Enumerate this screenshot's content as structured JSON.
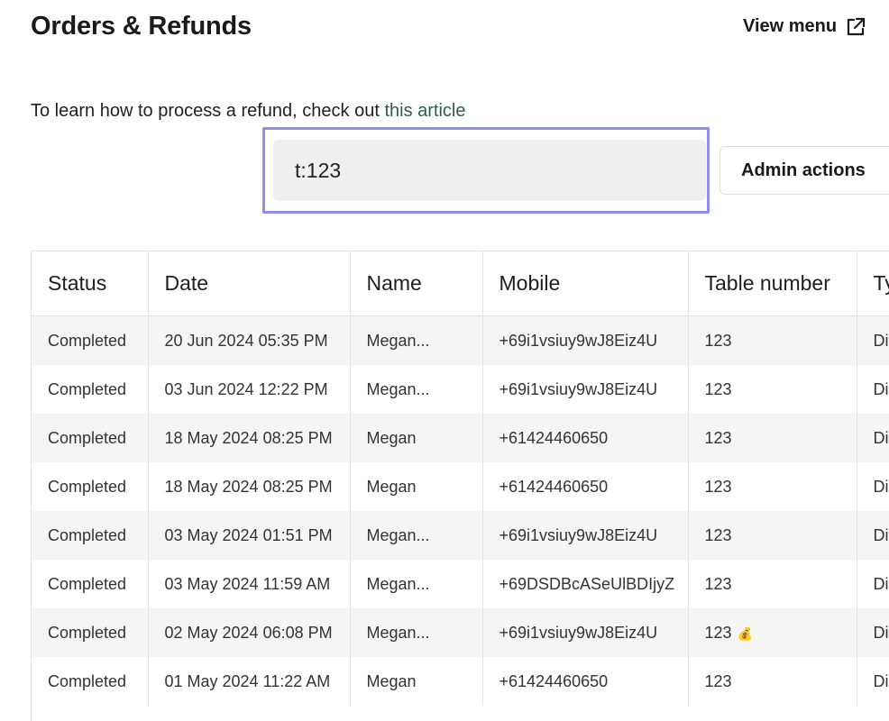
{
  "header": {
    "title": "Orders & Refunds",
    "view_menu_label": "View menu",
    "view_menu_icon": "external-link-icon"
  },
  "help": {
    "text": "To learn how to process a refund, check out ",
    "link_text": "this article"
  },
  "search": {
    "value": "t:123",
    "focus_color": "#8f8ef0"
  },
  "admin_actions_label": "Admin actions",
  "table": {
    "columns": [
      "Status",
      "Date",
      "Name",
      "Mobile",
      "Table number",
      "Type"
    ],
    "rows": [
      {
        "status": "Completed",
        "date": "20 Jun 2024 05:35 PM",
        "name": "Megan...",
        "mobile": "+69i1vsiuy9wJ8Eiz4U",
        "table_number": "123",
        "type": "Dine-in",
        "icon": ""
      },
      {
        "status": "Completed",
        "date": "03 Jun 2024 12:22 PM",
        "name": "Megan...",
        "mobile": "+69i1vsiuy9wJ8Eiz4U",
        "table_number": "123",
        "type": "Dine-in",
        "icon": ""
      },
      {
        "status": "Completed",
        "date": "18 May 2024 08:25 PM",
        "name": "Megan",
        "mobile": "+61424460650",
        "table_number": "123",
        "type": "Dine-in",
        "icon": ""
      },
      {
        "status": "Completed",
        "date": "18 May 2024 08:25 PM",
        "name": "Megan",
        "mobile": "+61424460650",
        "table_number": "123",
        "type": "Dine-in",
        "icon": ""
      },
      {
        "status": "Completed",
        "date": "03 May 2024 01:51 PM",
        "name": "Megan...",
        "mobile": "+69i1vsiuy9wJ8Eiz4U",
        "table_number": "123",
        "type": "Dine-in",
        "icon": ""
      },
      {
        "status": "Completed",
        "date": "03 May 2024 11:59 AM",
        "name": "Megan...",
        "mobile": "+69DSDBcASeUlBDIjyZ",
        "table_number": "123",
        "type": "Dine-in",
        "icon": ""
      },
      {
        "status": "Completed",
        "date": "02 May 2024 06:08 PM",
        "name": "Megan...",
        "mobile": "+69i1vsiuy9wJ8Eiz4U",
        "table_number": "123",
        "type": "Dine-in",
        "icon": "💰"
      },
      {
        "status": "Completed",
        "date": "01 May 2024 11:22 AM",
        "name": "Megan",
        "mobile": "+61424460650",
        "table_number": "123",
        "type": "Dine-in",
        "icon": ""
      }
    ]
  }
}
